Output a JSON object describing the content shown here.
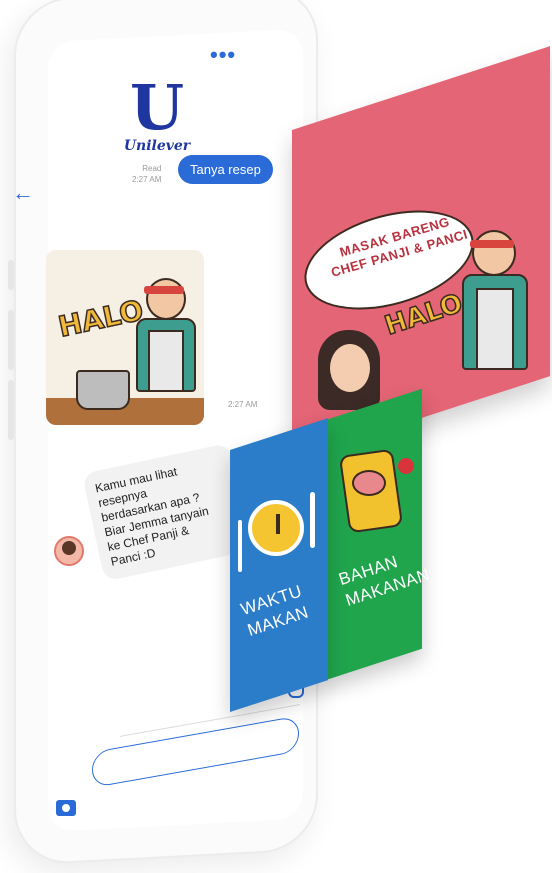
{
  "header": {
    "more_icon": "more-dots-icon",
    "back_icon": "back-arrow-icon",
    "logo": {
      "letter": "U",
      "wordmark": "Unilever"
    }
  },
  "messages": {
    "outgoing": {
      "text": "Tanya resep",
      "status": "Read",
      "time": "2:27 AM"
    },
    "sticker_time": "2:27 AM",
    "sticker_text": "HALO",
    "incoming_lines": [
      "Kamu mau lihat",
      "resepnya",
      "berdasarkan apa ?",
      "Biar Jemma tanyain",
      "ke Chef Panji &",
      "Panci :D"
    ]
  },
  "cards": {
    "pink": {
      "speech_line1": "MASAK BARENG",
      "speech_line2": "CHEF PANJI & PANCI",
      "halo": "HALO"
    },
    "blue": {
      "line1": "WAKTU",
      "line2": "MAKAN"
    },
    "green": {
      "line1": "BAHAN",
      "line2": "MAKANAN"
    }
  },
  "composer": {
    "camera_icon": "camera-icon",
    "mic_icon": "mic-icon"
  },
  "colors": {
    "accent": "#2a6bd8",
    "brand": "#1f36a0",
    "pink": "#e46575",
    "blue": "#2b7cc9",
    "green": "#20a54d"
  }
}
